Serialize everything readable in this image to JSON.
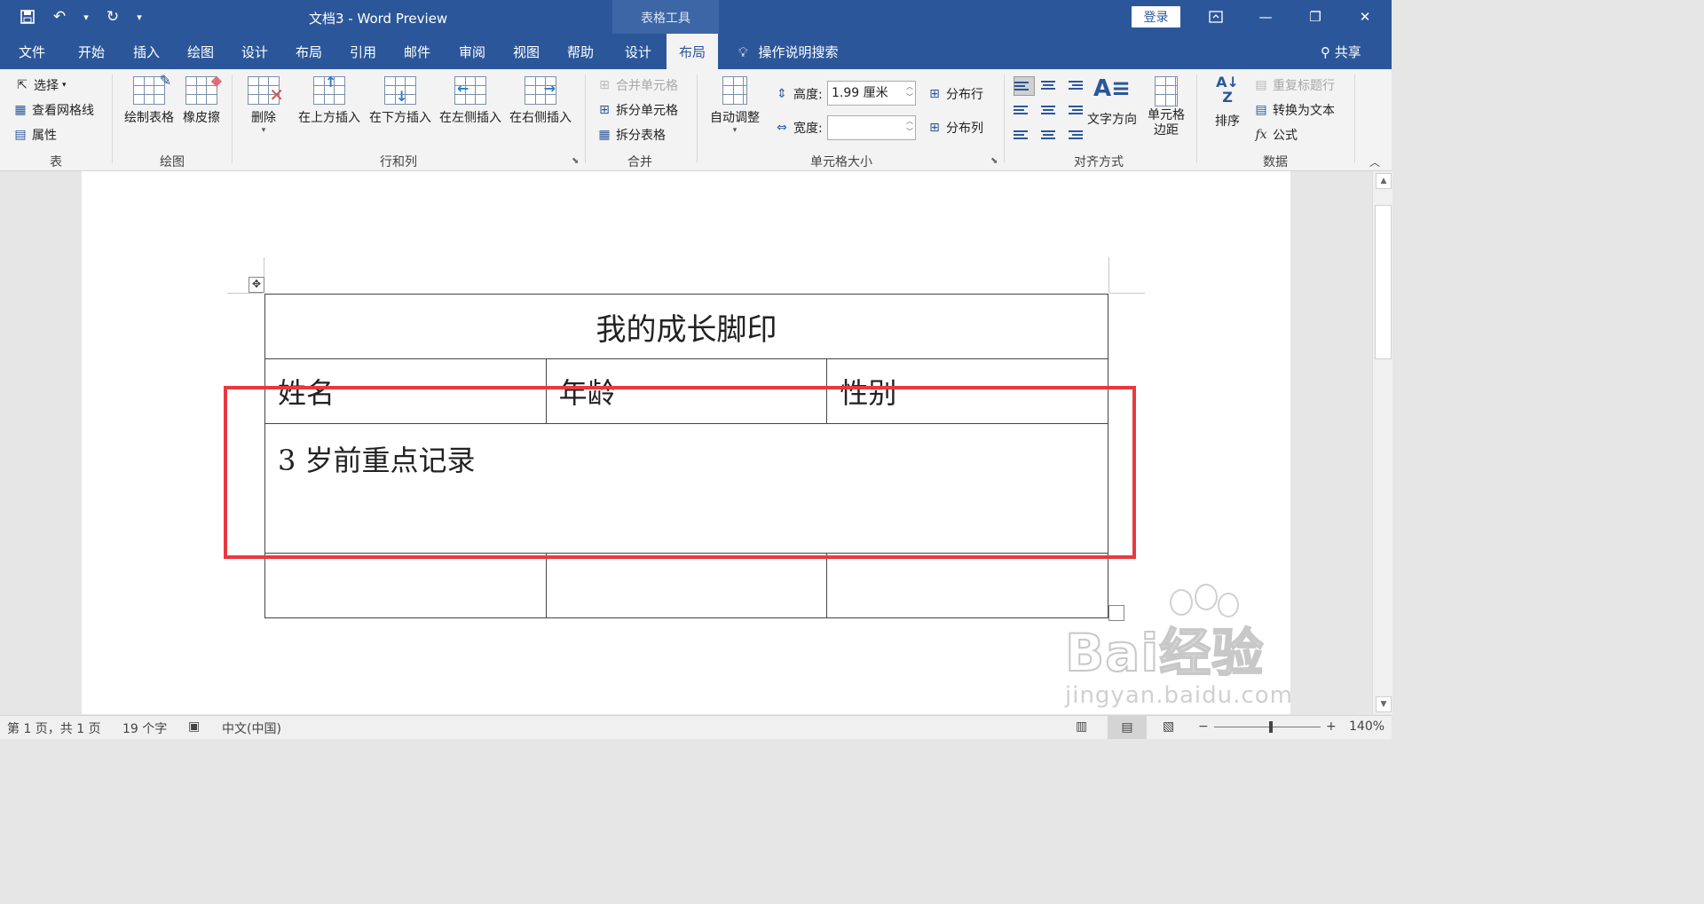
{
  "window": {
    "title": "文档3  -  Word Preview",
    "contextual_tab_group": "表格工具",
    "login_label": "登录"
  },
  "tabs": [
    {
      "label": "文件"
    },
    {
      "label": "开始"
    },
    {
      "label": "插入"
    },
    {
      "label": "绘图"
    },
    {
      "label": "设计"
    },
    {
      "label": "布局"
    },
    {
      "label": "引用"
    },
    {
      "label": "邮件"
    },
    {
      "label": "审阅"
    },
    {
      "label": "视图"
    },
    {
      "label": "帮助"
    },
    {
      "label": "设计"
    },
    {
      "label": "布局",
      "active": true
    }
  ],
  "tell_me": "操作说明搜索",
  "share": "共享",
  "ribbon": {
    "table_group": {
      "label": "表",
      "select": "选择",
      "view_gridlines": "查看网格线",
      "properties": "属性"
    },
    "draw_group": {
      "label": "绘图",
      "draw_table": "绘制表格",
      "eraser": "橡皮擦"
    },
    "rows_cols_group": {
      "label": "行和列",
      "delete": "删除",
      "insert_above": "在上方插入",
      "insert_below": "在下方插入",
      "insert_left": "在左侧插入",
      "insert_right": "在右侧插入"
    },
    "merge_group": {
      "label": "合并",
      "merge_cells": "合并单元格",
      "split_cells": "拆分单元格",
      "split_table": "拆分表格"
    },
    "cell_size_group": {
      "label": "单元格大小",
      "autofit": "自动调整",
      "height_label": "高度:",
      "height_value": "1.99 厘米",
      "width_label": "宽度:",
      "width_value": "",
      "distribute_rows": "分布行",
      "distribute_cols": "分布列"
    },
    "alignment_group": {
      "label": "对齐方式",
      "text_direction": "文字方向",
      "cell_margins_line1": "单元格",
      "cell_margins_line2": "边距"
    },
    "data_group": {
      "label": "数据",
      "sort": "排序",
      "repeat_header": "重复标题行",
      "convert_to_text": "转换为文本",
      "formula": "公式"
    }
  },
  "document": {
    "table": {
      "title": "我的成长脚印",
      "headers": [
        "姓名",
        "年龄",
        "性别"
      ],
      "note_row": "3 岁前重点记录",
      "empty_row": [
        "",
        "",
        ""
      ]
    }
  },
  "watermark": {
    "brand": "Bai经验",
    "url": "jingyan.baidu.com"
  },
  "status": {
    "page": "第 1 页，共 1 页",
    "words": "19 个字",
    "language": "中文(中国)",
    "zoom": "140%"
  },
  "colors": {
    "brand": "#2b579a",
    "highlight": "#e8393f"
  }
}
